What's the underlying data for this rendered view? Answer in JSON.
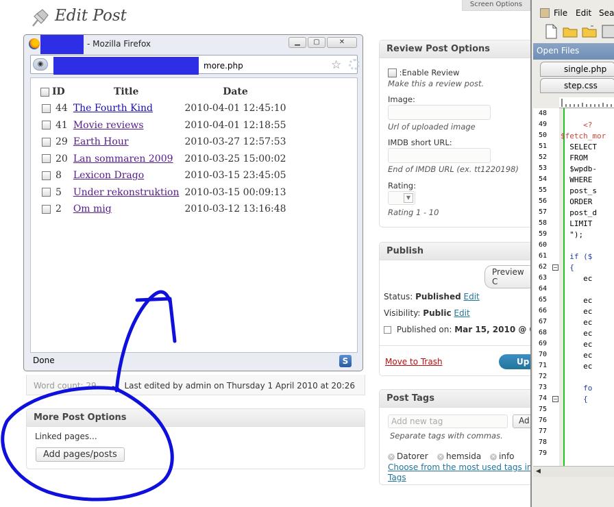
{
  "wp": {
    "page_title": "Edit Post",
    "screen_options": "Screen Options",
    "last_edited": "Last edited by admin on Thursday 1 April 2010 at 20:26",
    "last_edited_left": "Word count: 29",
    "more_post_options": {
      "title": "More Post Options",
      "linked_label": "Linked pages...",
      "add_button": "Add pages/posts"
    },
    "review": {
      "title": "Review Post Options",
      "enable_label": ":Enable Review",
      "enable_note": "Make this a review post.",
      "image_label": "Image:",
      "image_note": "Url of uploaded image",
      "imdb_label": "IMDB short URL:",
      "imdb_note": "End of IMDB URL (ex. tt1220198)",
      "rating_label": "Rating:",
      "rating_note": "Rating 1 - 10"
    },
    "publish": {
      "title": "Publish",
      "preview_button": "Preview C",
      "status_label": "Status:",
      "status_value": "Published",
      "visibility_label": "Visibility:",
      "visibility_value": "Public",
      "edit_link": "Edit",
      "published_on_label": "Published on:",
      "published_on_value": "Mar 15, 2010 @ 0",
      "trash_link": "Move to Trash",
      "update_button": "Up"
    },
    "tags": {
      "title": "Post Tags",
      "placeholder": "Add new tag",
      "add_button": "Ad",
      "hint": "Separate tags with commas.",
      "items": [
        "Datorer",
        "hemsida",
        "info"
      ],
      "choose_link": "Choose from the most used tags in",
      "choose_link_2": "Tags"
    }
  },
  "firefox": {
    "title": "- Mozilla Firefox",
    "url": "more.php",
    "status": "Done",
    "table": {
      "headers": {
        "id": "ID",
        "title": "Title",
        "date": "Date"
      },
      "rows": [
        {
          "id": "44",
          "title": "The Fourth Kind",
          "date": "2010-04-01 12:45:10"
        },
        {
          "id": "41",
          "title": "Movie reviews",
          "date": "2010-04-01 12:18:55"
        },
        {
          "id": "29",
          "title": "Earth Hour",
          "date": "2010-03-27 12:57:53"
        },
        {
          "id": "20",
          "title": "Lan sommaren 2009",
          "date": "2010-03-25 15:00:02"
        },
        {
          "id": "8",
          "title": "Lexicon Drago",
          "date": "2010-03-15 23:45:05"
        },
        {
          "id": "5",
          "title": "Under rekonstruktion",
          "date": "2010-03-15 00:09:13"
        },
        {
          "id": "2",
          "title": "Om mig",
          "date": "2010-03-12 13:16:48"
        }
      ]
    }
  },
  "editor": {
    "menu": {
      "file": "File",
      "edit": "Edit",
      "search": "Sear"
    },
    "open_files": "Open Files",
    "tabs": [
      "single.php",
      "step.css"
    ],
    "line_numbers": [
      "48",
      "49",
      "50",
      "51",
      "52",
      "53",
      "54",
      "55",
      "56",
      "57",
      "58",
      "59",
      "60",
      "61",
      "62",
      "63",
      "64",
      "65",
      "66",
      "67",
      "68",
      "69",
      "70",
      "71",
      "72",
      "73",
      "74",
      "75",
      "76",
      "77",
      "78",
      "79"
    ],
    "code": {
      "l49": "     <?",
      "l50": "$fetch_mor",
      "l51": "  SELECT",
      "l52": "  FROM",
      "l53": "  $wpdb-",
      "l54": "  WHERE",
      "l55": "  post_s",
      "l56": "  ORDER",
      "l57": "  post_d",
      "l58": "  LIMIT",
      "l59": "  \");",
      "l61": "  if ($",
      "l62": "  {",
      "l63": "     ec",
      "l65": "     ec",
      "l66": "     ec",
      "l67": "     ec",
      "l68": "     ec",
      "l69": "     ec",
      "l70": "     ec",
      "l71": "     ec",
      "l73": "     fo",
      "l74": "     {"
    }
  },
  "colors": {
    "redaction": "#2e2ee6",
    "annotation": "#1010dd",
    "wp_link": "#21759b",
    "trash": "#bc0b0b",
    "update_button": "#21759b",
    "visited_link": "#551a8b",
    "code_variable": "#c5463b"
  }
}
